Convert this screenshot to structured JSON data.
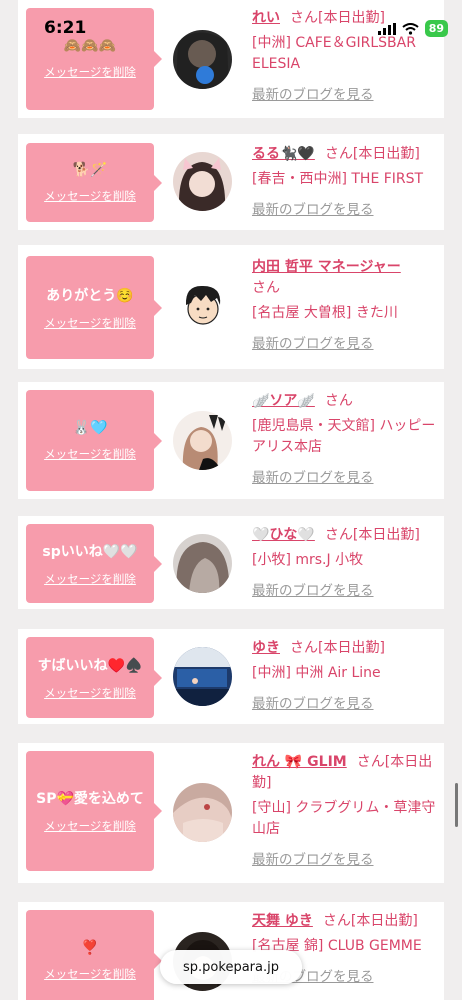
{
  "status": {
    "time": "6:21",
    "battery": "89"
  },
  "delete_label": "メッセージを削除",
  "blog_label": "最新のブログを見る",
  "honorific": "さん",
  "url": "sp.pokepara.jp",
  "cards": [
    {
      "message": "🙈🙈🙈",
      "name": "れい",
      "suffix": "さん[本日出勤]",
      "shop": "[中洲] CAFE＆GIRLSBAR ELESIA",
      "avatar": "avatar-1"
    },
    {
      "message": "🐕🪄",
      "name": "るる🐈‍⬛🖤",
      "suffix": "さん[本日出勤]",
      "shop": "[春吉・西中洲] THE FIRST",
      "avatar": "avatar-2"
    },
    {
      "message": "ありがとう☺️",
      "name": "内田 哲平 マネージャー",
      "suffix": "さん",
      "shop": "[名古屋 大曽根] きた川",
      "avatar": "avatar-3"
    },
    {
      "message": "🐰🩵",
      "name": "🪽ソア🪽",
      "suffix": "さん",
      "shop": "[鹿児島県・天文館] ハッピーアリス本店",
      "avatar": "avatar-4"
    },
    {
      "message": "spいいね🤍🤍",
      "name": "🤍ひな🤍",
      "suffix": "さん[本日出勤]",
      "shop": "[小牧] mrs.J 小牧",
      "avatar": "avatar-5"
    },
    {
      "message": "すばいいね♥️♠️",
      "name": "ゆき",
      "suffix": "さん[本日出勤]",
      "shop": "[中洲] 中洲 Air Line",
      "avatar": "avatar-6"
    },
    {
      "message": "SP💝愛を込めて",
      "name": "れん 🎀 GLIM",
      "suffix": "さん[本日出勤]",
      "shop": "[守山] クラブグリム・草津守山店",
      "avatar": "avatar-7"
    },
    {
      "message": "❣️",
      "name": "天舞 ゆき",
      "suffix": "さん[本日出勤]",
      "shop": "[名古屋 錦] CLUB GEMME",
      "avatar": "avatar-8"
    }
  ]
}
